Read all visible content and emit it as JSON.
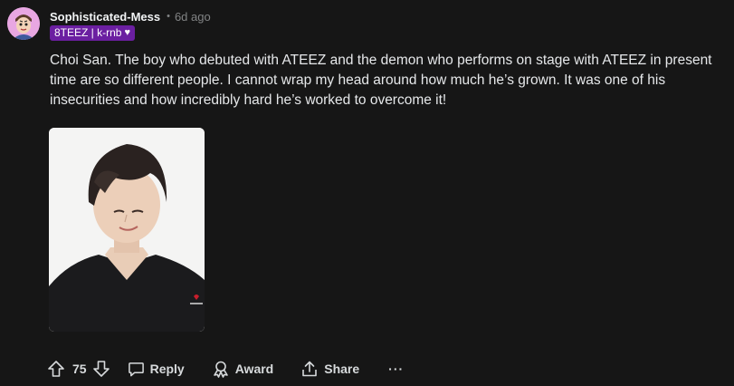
{
  "comment": {
    "username": "Sophisticated-Mess",
    "separator": "•",
    "time_ago": "6d ago",
    "flair_text": "8TEEZ | k-rnb",
    "flair_heart": "♥",
    "body": "Choi San. The boy who debuted with ATEEZ and the demon who performs on stage with ATEEZ in present time are so different people. I cannot wrap my head around how much he’s grown. It was one of his insecurities and how incredibly hard he’s worked to overcome it!"
  },
  "actions": {
    "vote_count": "75",
    "reply_label": "Reply",
    "award_label": "Award",
    "share_label": "Share",
    "more_label": "···"
  },
  "colors": {
    "background": "#161616",
    "flair_bg": "#6b1fa1",
    "avatar_bg": "#e8a7e2",
    "muted_text": "#818384"
  },
  "icons": {
    "upvote": "arrow-up-icon",
    "downvote": "arrow-down-icon",
    "reply": "speech-bubble-icon",
    "award": "award-ribbon-icon",
    "share": "share-upload-icon",
    "more": "ellipsis-icon"
  }
}
